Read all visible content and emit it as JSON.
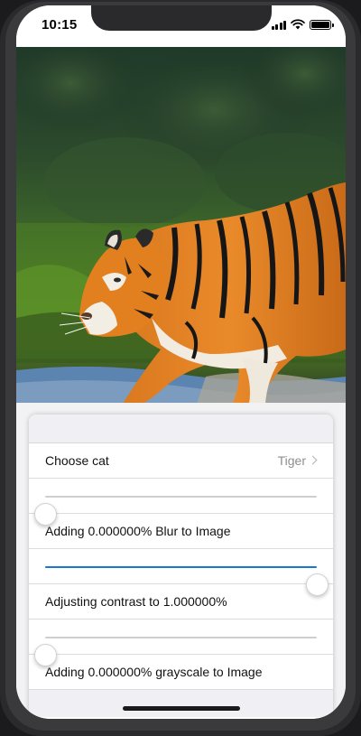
{
  "status_bar": {
    "time": "10:15",
    "icons": [
      "signal-icon",
      "wifi-icon",
      "battery-icon"
    ]
  },
  "photo": {
    "subject": "tiger-photo"
  },
  "settings": {
    "choose_cat": {
      "label": "Choose cat",
      "value": "Tiger"
    },
    "blur": {
      "label": "Adding 0.000000% Blur to Image",
      "slider_fraction": 0.0
    },
    "contrast": {
      "label": "Adjusting contrast to 1.000000%",
      "slider_fraction": 1.0
    },
    "grayscale": {
      "label": "Adding 0.000000% grayscale to Image",
      "slider_fraction": 0.0
    }
  },
  "colors": {
    "accent": "#1976d2",
    "separator": "#dcdce0",
    "secondary_text": "#8e8e93"
  }
}
